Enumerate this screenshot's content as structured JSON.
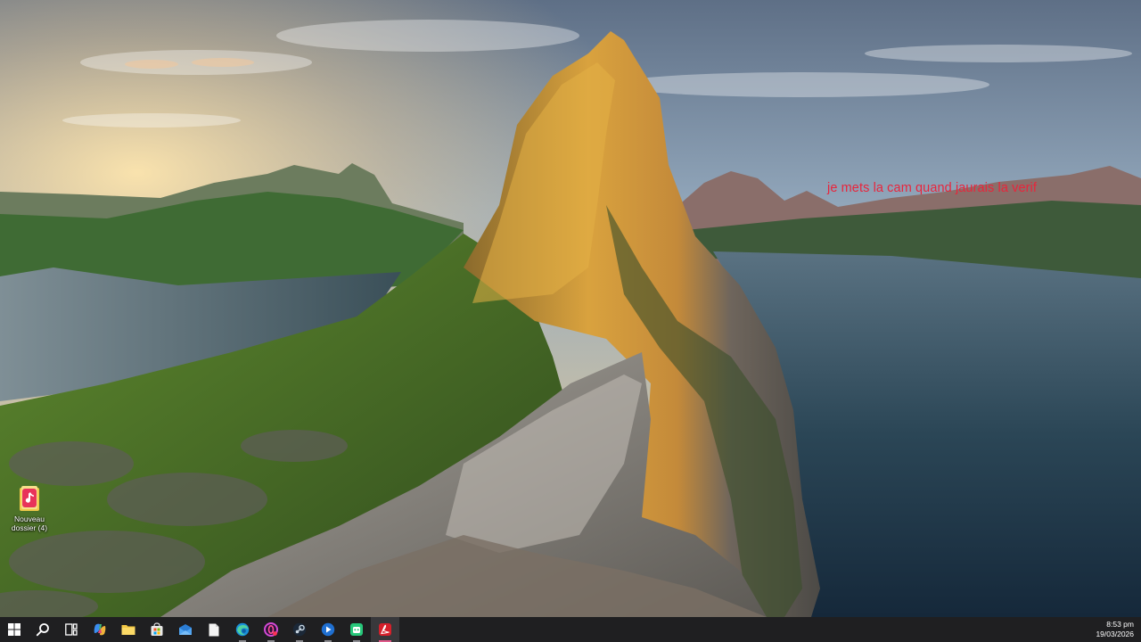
{
  "desktop": {
    "overlay_text": "je mets la cam quand jaurais la verif",
    "icons": [
      {
        "label": "Nouveau dossier (4)",
        "icon": "tiktok-folder-icon"
      }
    ]
  },
  "taskbar": {
    "apps": [
      {
        "name": "start",
        "icon": "windows-start-icon"
      },
      {
        "name": "search",
        "icon": "search-icon"
      },
      {
        "name": "task-view",
        "icon": "task-view-icon"
      },
      {
        "name": "copilot",
        "icon": "copilot-icon"
      },
      {
        "name": "file-explorer",
        "icon": "folder-icon"
      },
      {
        "name": "microsoft-store",
        "icon": "store-icon"
      },
      {
        "name": "mail",
        "icon": "mail-icon"
      },
      {
        "name": "notepad",
        "icon": "document-icon"
      },
      {
        "name": "edge",
        "icon": "edge-icon"
      },
      {
        "name": "opera-gx",
        "icon": "browser-icon"
      },
      {
        "name": "steam",
        "icon": "steam-icon"
      },
      {
        "name": "app-blue",
        "icon": "app-circle-icon"
      },
      {
        "name": "app-green",
        "icon": "app-green-icon"
      },
      {
        "name": "adobe-acrobat",
        "icon": "acrobat-icon"
      }
    ],
    "clock": {
      "time": "8:53 pm",
      "date": "19/03/2026"
    }
  },
  "colors": {
    "overlay_text": "#e8253c",
    "taskbar_bg": "#1f1f21",
    "active_indicator": "#e05a8a"
  }
}
